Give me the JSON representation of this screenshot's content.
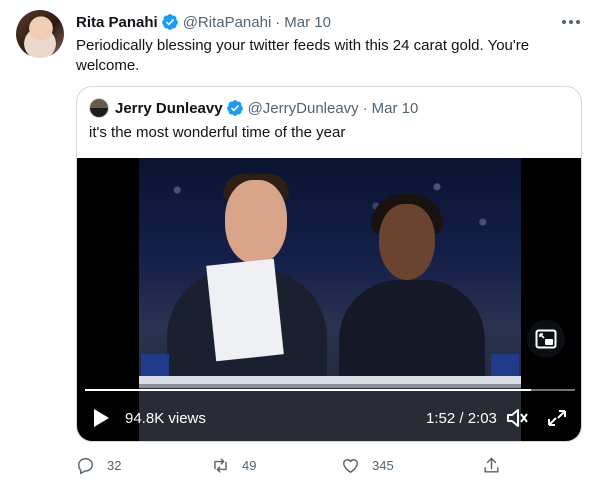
{
  "tweet": {
    "author_name": "Rita Panahi",
    "handle": "@RitaPanahi",
    "date": "Mar 10",
    "text": "Periodically blessing your twitter feeds with this 24 carat gold. You're welcome.",
    "more_icon": "more-horizontal-icon",
    "verified_icon": "verified-badge-icon"
  },
  "quote": {
    "author_name": "Jerry Dunleavy",
    "handle": "@JerryDunleavy",
    "date": "Mar 10",
    "text": "it's the most wonderful time of the year"
  },
  "video": {
    "views": "94.8K views",
    "time": "1:52 / 2:03",
    "progress": 0.91,
    "play_icon": "play-icon",
    "volume_icon": "volume-muted-icon",
    "fullscreen_icon": "fullscreen-icon",
    "pip_icon": "picture-in-picture-icon"
  },
  "actions": {
    "replies": "32",
    "retweets": "49",
    "likes": "345"
  },
  "colors": {
    "text": "#0f1419",
    "muted": "#536471",
    "verified": "#1d9bf0",
    "border": "#cfd9de"
  }
}
